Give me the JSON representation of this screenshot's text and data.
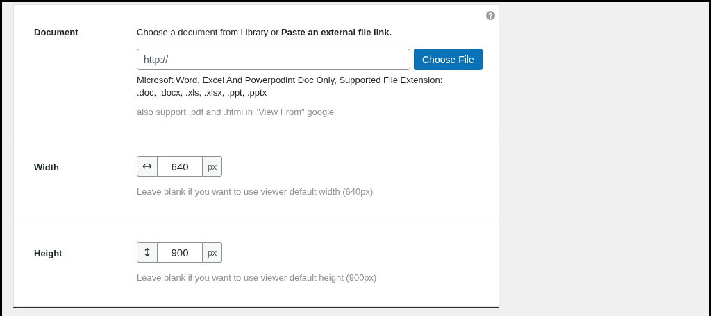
{
  "settings": [
    {
      "kind": "document",
      "label": "Document",
      "intro": "Choose a document from Library or **Paste an external file link.**",
      "url_field": {
        "placeholder": "http://"
      },
      "button": "Choose File",
      "notes": [
        "Microsoft Word, Excel And Powerpodint Doc Only, Supported File Extension: .doc, .docx, .xls, .xlsx, .ppt, .pptx"
      ],
      "hint": "also support .pdf and .html in \"View From\" google"
    },
    {
      "kind": "dimension",
      "label": "Width",
      "vertical": false,
      "value": "640",
      "unit": "px",
      "hint": "Leave blank if you want to use viewer default width (640px)"
    },
    {
      "kind": "dimension",
      "label": "Height",
      "vertical": true,
      "value": "900",
      "unit": "px",
      "hint": "Leave blank if you want to use viewer default height (900px)"
    }
  ]
}
